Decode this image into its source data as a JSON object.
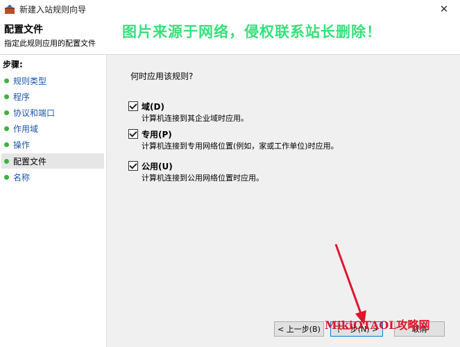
{
  "window": {
    "title": "新建入站规则向导",
    "close_glyph": "✕",
    "accent": "#0078d7"
  },
  "header": {
    "title": "配置文件",
    "subtitle": "指定此规则应用的配置文件",
    "watermark": "图片来源于网络，侵权联系站长删除！"
  },
  "sidebar": {
    "heading": "步骤:",
    "items": [
      {
        "label": "规则类型"
      },
      {
        "label": "程序"
      },
      {
        "label": "协议和端口"
      },
      {
        "label": "作用域"
      },
      {
        "label": "操作"
      },
      {
        "label": "配置文件"
      },
      {
        "label": "名称"
      }
    ],
    "active_index": 5
  },
  "main": {
    "question": "何时应用该规则?",
    "options": [
      {
        "label": "域(D)",
        "desc": "计算机连接到其企业域时应用。",
        "checked": true
      },
      {
        "label": "专用(P)",
        "desc": "计算机连接到专用网络位置(例如，家或工作单位)时应用。",
        "checked": true
      },
      {
        "label": "公用(U)",
        "desc": "计算机连接到公用网络位置时应用。",
        "checked": true
      }
    ]
  },
  "buttons": {
    "back": "< 上一步(B)",
    "next": "下一步(N) >",
    "cancel": "取消"
  },
  "overlay": {
    "site_watermark": "MikiOTAOL攻略网",
    "arrow_color": "#e0142a"
  }
}
